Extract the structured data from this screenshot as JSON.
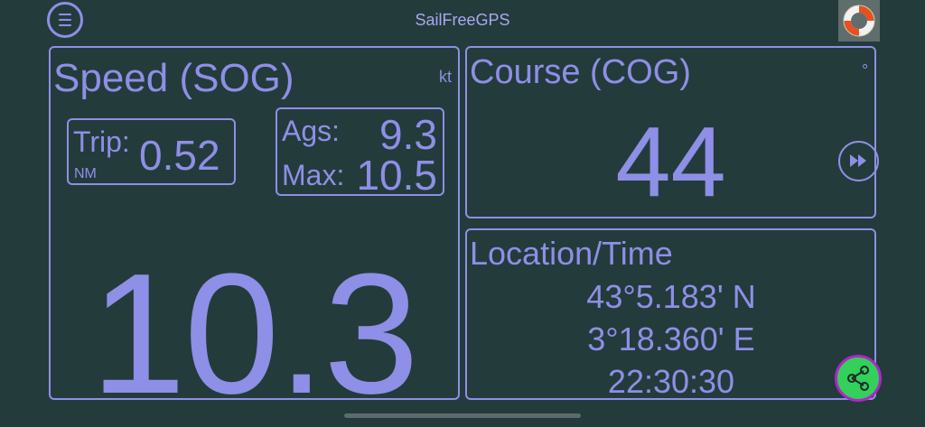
{
  "header": {
    "title": "SailFreeGPS",
    "menu_icon": "hamburger-icon",
    "help_icon": "lifebuoy-icon"
  },
  "speed": {
    "title": "Speed (SOG)",
    "unit": "kt",
    "value": "10.3",
    "trip": {
      "label": "Trip:",
      "value": "0.52",
      "unit": "NM"
    },
    "avg": {
      "label": "Ags:",
      "value": "9.3"
    },
    "max": {
      "label": "Max:",
      "value": "10.5"
    }
  },
  "course": {
    "title": "Course (COG)",
    "unit": "°",
    "value": "44",
    "next_icon": "fast-forward-icon"
  },
  "location": {
    "title": "Location/Time",
    "latitude": "43°5.183' N",
    "longitude": "3°18.360' E",
    "time": "22:30:30",
    "share_icon": "share-icon"
  },
  "colors": {
    "background": "#243b3c",
    "accent": "#8e8fe6",
    "share_button": "#33d05a",
    "share_ring": "#b125c8"
  }
}
